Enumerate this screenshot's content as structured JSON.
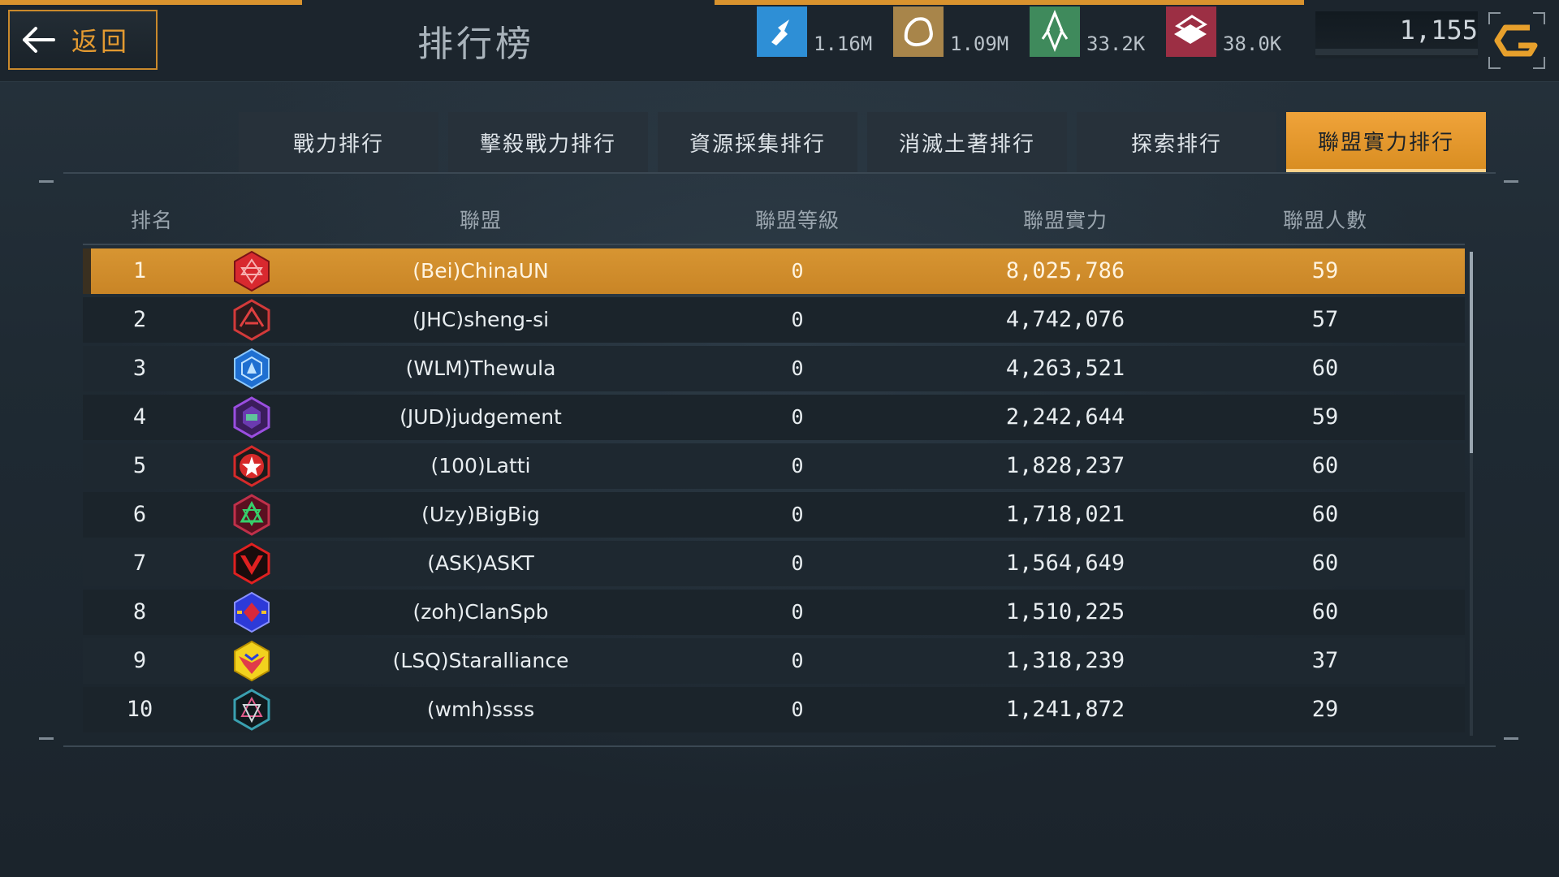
{
  "header": {
    "back_label": "返回",
    "title": "排行榜"
  },
  "resources": [
    {
      "icon": "blue-crystal-icon",
      "value": "1.16M",
      "color": "#2e8fd6"
    },
    {
      "icon": "ore-rock-icon",
      "value": "1.09M",
      "color": "#a8854a"
    },
    {
      "icon": "green-crystal-icon",
      "value": "33.2K",
      "color": "#3f8a5c"
    },
    {
      "icon": "alloy-bars-icon",
      "value": "38.0K",
      "color": "#9c2f44"
    }
  ],
  "currency": {
    "amount": "1,155",
    "icon": "gold-logo-icon"
  },
  "tabs": [
    {
      "label": "戰力排行",
      "active": false
    },
    {
      "label": "擊殺戰力排行",
      "active": false
    },
    {
      "label": "資源採集排行",
      "active": false
    },
    {
      "label": "消滅土著排行",
      "active": false
    },
    {
      "label": "探索排行",
      "active": false
    },
    {
      "label": "聯盟實力排行",
      "active": true
    }
  ],
  "table": {
    "headers": {
      "rank": "排名",
      "alliance": "聯盟",
      "level": "聯盟等級",
      "power": "聯盟實力",
      "members": "聯盟人數"
    },
    "rows": [
      {
        "rank": "1",
        "name": "(Bei)ChinaUN",
        "level": "0",
        "power": "8,025,786",
        "members": "59",
        "emblem": "red-hex-emblem-icon"
      },
      {
        "rank": "2",
        "name": "(JHC)sheng-si",
        "level": "0",
        "power": "4,742,076",
        "members": "57",
        "emblem": "red-wings-emblem-icon"
      },
      {
        "rank": "3",
        "name": "(WLM)Thewula",
        "level": "0",
        "power": "4,263,521",
        "members": "60",
        "emblem": "blue-hex-emblem-icon"
      },
      {
        "rank": "4",
        "name": "(JUD)judgement",
        "level": "0",
        "power": "2,242,644",
        "members": "59",
        "emblem": "purple-hex-emblem-icon"
      },
      {
        "rank": "5",
        "name": "(100)Latti",
        "level": "0",
        "power": "1,828,237",
        "members": "60",
        "emblem": "red-star-emblem-icon"
      },
      {
        "rank": "6",
        "name": "(Uzy)BigBig",
        "level": "0",
        "power": "1,718,021",
        "members": "60",
        "emblem": "green-triangle-emblem-icon"
      },
      {
        "rank": "7",
        "name": "(ASK)ASKT",
        "level": "0",
        "power": "1,564,649",
        "members": "60",
        "emblem": "red-v-emblem-icon"
      },
      {
        "rank": "8",
        "name": "(zoh)ClanSpb",
        "level": "0",
        "power": "1,510,225",
        "members": "60",
        "emblem": "blue-red-emblem-icon"
      },
      {
        "rank": "9",
        "name": "(LSQ)Staralliance",
        "level": "0",
        "power": "1,318,239",
        "members": "37",
        "emblem": "yellow-wings-emblem-icon"
      },
      {
        "rank": "10",
        "name": "(wmh)ssss",
        "level": "0",
        "power": "1,241,872",
        "members": "29",
        "emblem": "dark-teal-emblem-icon"
      }
    ]
  }
}
